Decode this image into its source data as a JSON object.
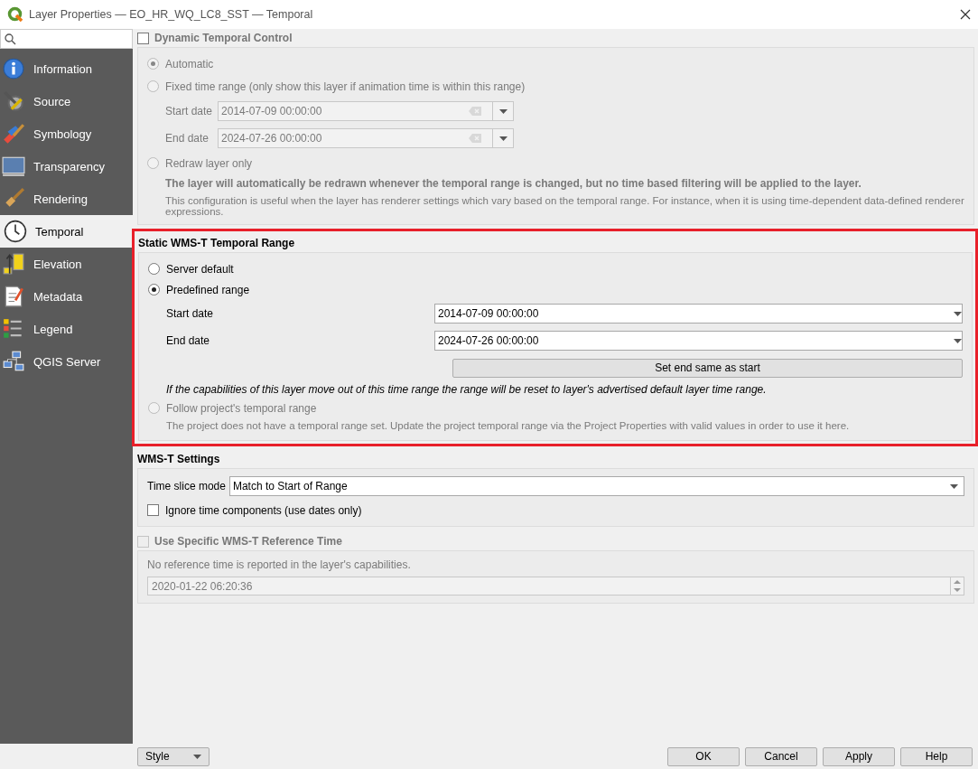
{
  "window": {
    "title": "Layer Properties — EO_HR_WQ_LC8_SST — Temporal"
  },
  "sidebar": {
    "items": [
      {
        "label": "Information",
        "selected": false
      },
      {
        "label": "Source",
        "selected": false
      },
      {
        "label": "Symbology",
        "selected": false
      },
      {
        "label": "Transparency",
        "selected": false
      },
      {
        "label": "Rendering",
        "selected": false
      },
      {
        "label": "Temporal",
        "selected": true
      },
      {
        "label": "Elevation",
        "selected": false
      },
      {
        "label": "Metadata",
        "selected": false
      },
      {
        "label": "Legend",
        "selected": false
      },
      {
        "label": "QGIS Server",
        "selected": false
      }
    ]
  },
  "dynamic_temporal": {
    "title": "Dynamic Temporal Control",
    "checked": false,
    "disabled": true,
    "options": [
      {
        "label": "Automatic",
        "selected": true
      },
      {
        "label": "Fixed time range (only show this layer if animation time is within this range)",
        "selected": false
      },
      {
        "label": "Redraw layer only",
        "selected": false
      }
    ],
    "start": {
      "label": "Start date",
      "value": "2014-07-09 00:00:00"
    },
    "end": {
      "label": "End date",
      "value": "2024-07-26 00:00:00"
    },
    "bold_note": "The layer will automatically be redrawn whenever the temporal range is changed, but no time based filtering will be applied to the layer.",
    "note": "This configuration is useful when the layer has renderer settings which vary based on the temporal range. For instance, when it is using time-dependent data-defined renderer expressions."
  },
  "static_range": {
    "title": "Static WMS-T Temporal Range",
    "highlighted": true,
    "options": [
      {
        "label": "Server default",
        "selected": false,
        "disabled": false
      },
      {
        "label": "Predefined range",
        "selected": true,
        "disabled": false
      },
      {
        "label": "Follow project's temporal range",
        "selected": false,
        "disabled": true
      }
    ],
    "start": {
      "label": "Start date",
      "value": "2014-07-09 00:00:00"
    },
    "end": {
      "label": "End date",
      "value": "2024-07-26 00:00:00"
    },
    "button": "Set end same as start",
    "warning": "If the capabilities of this layer move out of this time range the range will be reset to layer's advertised default layer time range.",
    "follow_note": "The project does not have a temporal range set. Update the project temporal range via the Project Properties with valid values in order to use it here."
  },
  "wms_settings": {
    "title": "WMS-T Settings",
    "time_slice": {
      "label": "Time slice mode",
      "value": "Match to Start of Range"
    },
    "ignore_time": {
      "label": "Ignore time components (use dates only)",
      "checked": false
    }
  },
  "reference_time": {
    "title": "Use Specific WMS-T Reference Time",
    "checked": false,
    "disabled": true,
    "note": "No reference time is reported in the layer's capabilities.",
    "value": "2020-01-22 06:20:36"
  },
  "footer": {
    "style_button": "Style",
    "buttons": [
      "OK",
      "Cancel",
      "Apply",
      "Help"
    ]
  }
}
